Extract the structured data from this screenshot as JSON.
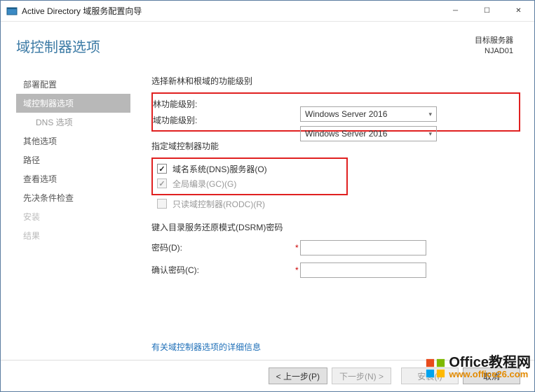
{
  "titlebar": {
    "title": "Active Directory 域服务配置向导"
  },
  "header": {
    "page_title": "域控制器选项",
    "target_label": "目标服务器",
    "target_name": "NJAD01"
  },
  "sidebar": {
    "items": [
      {
        "label": "部署配置"
      },
      {
        "label": "域控制器选项"
      },
      {
        "label": "DNS 选项"
      },
      {
        "label": "其他选项"
      },
      {
        "label": "路径"
      },
      {
        "label": "查看选项"
      },
      {
        "label": "先决条件检查"
      },
      {
        "label": "安装"
      },
      {
        "label": "结果"
      }
    ]
  },
  "form": {
    "section1_title": "选择新林和根域的功能级别",
    "forest_label": "林功能级别:",
    "domain_label": "域功能级别:",
    "forest_value": "Windows Server 2016",
    "domain_value": "Windows Server 2016",
    "section2_title": "指定域控制器功能",
    "chk_dns": "域名系统(DNS)服务器(O)",
    "chk_gc": "全局编录(GC)(G)",
    "chk_rodc": "只读域控制器(RODC)(R)",
    "section3_title": "键入目录服务还原模式(DSRM)密码",
    "pwd_label": "密码(D):",
    "confirm_label": "确认密码(C):",
    "link_more": "有关域控制器选项的详细信息"
  },
  "footer": {
    "prev": "< 上一步(P)",
    "next": "下一步(N) >",
    "install": "安装(I)",
    "cancel": "取消"
  },
  "watermark": {
    "line1": "Office教程网",
    "line2": "www.office26.com"
  }
}
